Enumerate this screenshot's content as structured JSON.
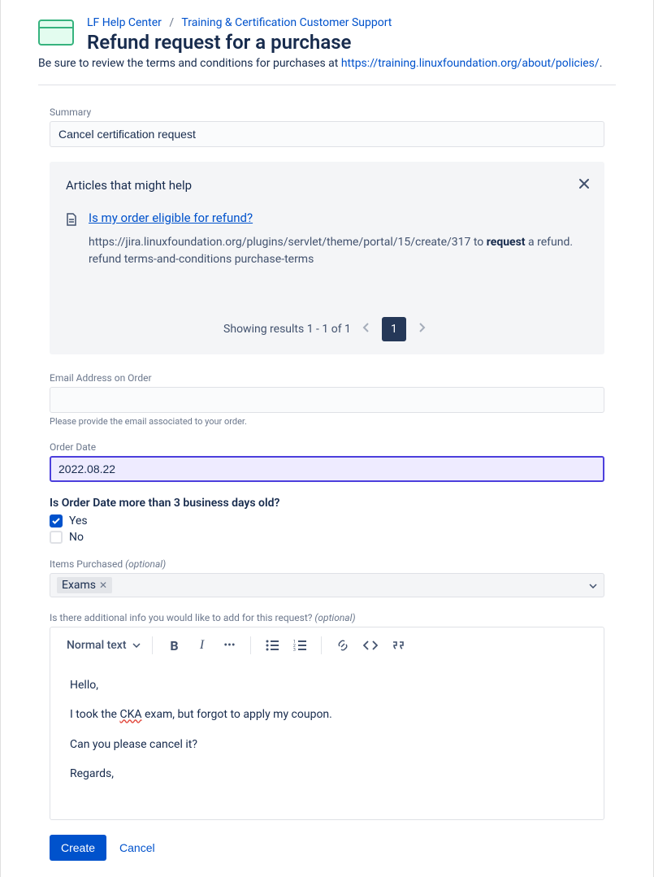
{
  "breadcrumb": {
    "item1": "LF Help Center",
    "sep": "/",
    "item2": "Training & Certification Customer Support"
  },
  "page_title": "Refund request for a purchase",
  "subheading": {
    "prefix": "Be sure to review the terms and conditions for purchases at ",
    "link": "https://training.linuxfoundation.org/about/policies/",
    "suffix": "."
  },
  "fields": {
    "summary": {
      "label": "Summary",
      "value": "Cancel certification request"
    },
    "email": {
      "label": "Email Address on Order",
      "value": "",
      "helper": "Please provide the email associated to your order."
    },
    "order_date": {
      "label": "Order Date",
      "value": "2022.08.22"
    },
    "old_order": {
      "label": "Is Order Date more than 3 business days old?",
      "opt_yes": "Yes",
      "opt_no": "No"
    },
    "items_purchased": {
      "label": "Items Purchased ",
      "optional": "(optional)",
      "tag": "Exams"
    },
    "additional_info": {
      "label": "Is there additional info you would like to add for this request? ",
      "optional": "(optional)"
    }
  },
  "suggestions": {
    "title": "Articles that might help",
    "article_title": "Is my order eligible for refund?",
    "snippet_1": "https://jira.linuxfoundation.org/plugins/servlet/theme/portal/15/create/317 to ",
    "snippet_bold": "request",
    "snippet_2": " a refund. refund terms-and-conditions purchase-terms",
    "pager_text": "Showing results 1 - 1 of 1",
    "page": "1"
  },
  "toolbar": {
    "style": "Normal text"
  },
  "editor": {
    "p1": "Hello,",
    "p2a": "I took the ",
    "p2err": "CKA",
    "p2b": " exam, but forgot to apply my coupon.",
    "p3": "Can you please cancel it?",
    "p4": "Regards,"
  },
  "actions": {
    "create": "Create",
    "cancel": "Cancel"
  }
}
